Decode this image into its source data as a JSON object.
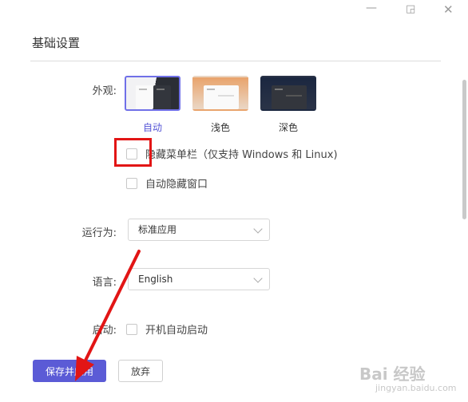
{
  "window": {
    "minimize_glyph": "—",
    "maximize_glyph": "◲",
    "close_glyph": "✕"
  },
  "section_title": "基础设置",
  "appearance": {
    "label": "外观:",
    "themes": [
      {
        "name": "自动",
        "selected": true
      },
      {
        "name": "浅色",
        "selected": false
      },
      {
        "name": "深色",
        "selected": false
      }
    ],
    "options": [
      {
        "label": "隐藏菜单栏（仅支持 Windows 和 Linux)",
        "checked": false
      },
      {
        "label": "自动隐藏窗口",
        "checked": false
      }
    ]
  },
  "run_as": {
    "label": "运行为:",
    "value": "标准应用"
  },
  "language": {
    "label": "语言:",
    "value": "English"
  },
  "startup": {
    "label": "启动:",
    "option": {
      "label": "开机自动启动",
      "checked": false
    }
  },
  "buttons": {
    "save": "保存并应用",
    "discard": "放弃"
  },
  "annotation": {
    "color": "#e21515"
  },
  "watermark": {
    "main": "Bai 经验",
    "sub": "jingyan.baidu.com"
  },
  "colors": {
    "accent": "#5b5bd6"
  }
}
